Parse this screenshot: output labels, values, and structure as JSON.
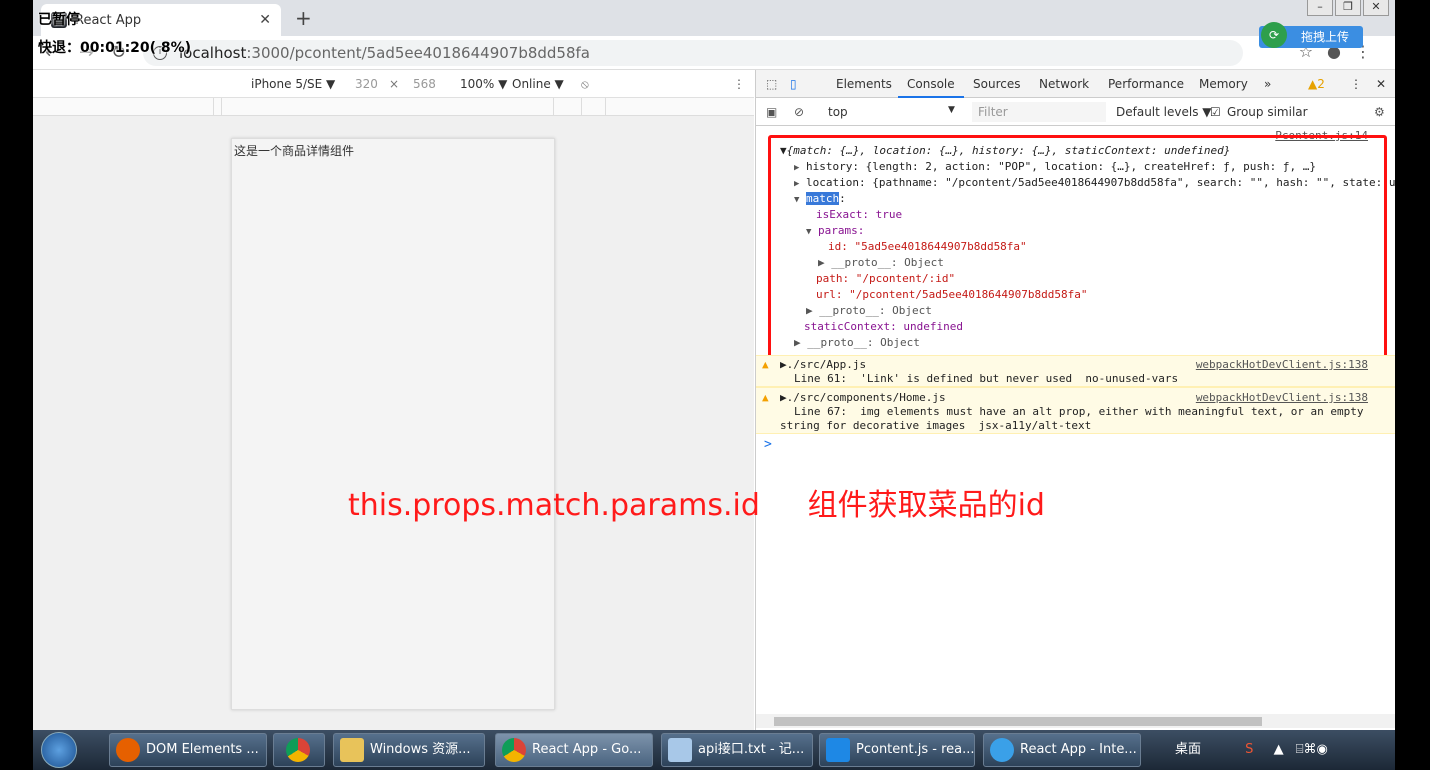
{
  "browser": {
    "tab_title": "React App",
    "url_host": "localhost",
    "url_path": ":3000/pcontent/5ad5ee4018644907b8dd58fa",
    "upload_button": "拖拽上传"
  },
  "device_toolbar": {
    "device": "iPhone 5/SE ▼",
    "width": "320",
    "times": "×",
    "height": "568",
    "zoom": "100% ▼",
    "network": "Online ▼"
  },
  "recorder": {
    "paused": "已暂停",
    "rewind": "快退：00:01:20( 8%)"
  },
  "page": {
    "component_text": "这是一个商品详情组件"
  },
  "devtools": {
    "tabs": [
      "Elements",
      "Console",
      "Sources",
      "Network",
      "Performance",
      "Memory"
    ],
    "more": "»",
    "warn_count": "▲2",
    "context": "top",
    "filter_placeholder": "Filter",
    "levels": "Default levels ▼",
    "group_similar": "Group similar",
    "source_link": "Pcontent.js:14"
  },
  "console": {
    "root": "▼{match: {…}, location: {…}, history: {…}, staticContext: undefined}",
    "history": "history: {length: 2, action: \"POP\", location: {…}, createHref: ƒ, push: ƒ, …}",
    "location": "location: {pathname: \"/pcontent/5ad5ee4018644907b8dd58fa\", search: \"\", hash: \"\", state: un",
    "match_key": "match",
    "isExact": "isExact: true",
    "params": "params:",
    "id": "id: \"5ad5ee4018644907b8dd58fa\"",
    "proto1": "▶ __proto__: Object",
    "path": "path: \"/pcontent/:id\"",
    "url": "url: \"/pcontent/5ad5ee4018644907b8dd58fa\"",
    "proto2": "▶ __proto__: Object",
    "staticContext": "staticContext: undefined",
    "proto3": "▶ __proto__: Object",
    "warn1_file": "▶./src/App.js",
    "warn1_msg": "Line 61:  'Link' is defined but never used  no-unused-vars",
    "warn1_link": "webpackHotDevClient.js:138",
    "warn2_file": "▶./src/components/Home.js",
    "warn2_msg": "Line 67:  img elements must have an alt prop, either with meaningful text, or an empty",
    "warn2_msg2": "string for decorative images  jsx-a11y/alt-text",
    "warn2_link": "webpackHotDevClient.js:138",
    "prompt": ">"
  },
  "overlay": {
    "text": "this.props.match.params.id     组件获取菜品的id"
  },
  "taskbar": {
    "items": [
      "DOM Elements ...",
      "",
      "Windows 资源...",
      "React App - Go...",
      "api接口.txt - 记...",
      "Pcontent.js - rea...",
      "React App - Inte..."
    ],
    "desktop": "桌面"
  },
  "colors": {
    "highlight_box": "#ff1010",
    "overlay_text": "#ff1a1a",
    "devtools_active": "#1a73e8"
  }
}
